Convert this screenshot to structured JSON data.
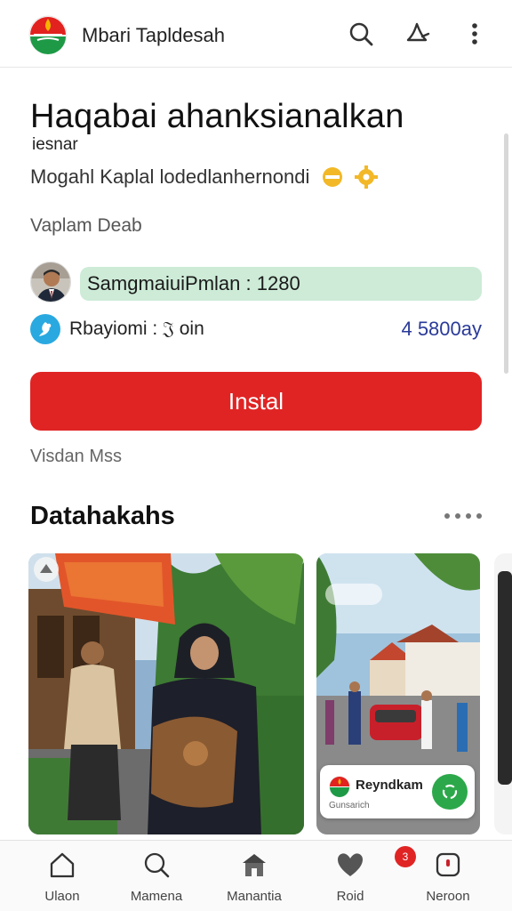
{
  "app_bar": {
    "app_name": "Mbari Tapldesah",
    "actions": [
      "search-icon",
      "share-icon",
      "more-vertical-icon"
    ]
  },
  "listing": {
    "title": "Haqabai ahanksianalkan",
    "subtitle": "iesnar",
    "description": "Mogahl Kaplal lodedlanhernondi",
    "secondary_text": "Vaplam Deab",
    "developer_pill": "SamgmaiuiPmlan : 1280",
    "rating_label": "Rbayiomi : 𝔍 oin",
    "rating_count": "4 5800ay",
    "install_label": "Instal",
    "below_button_text": "Visdan Mss"
  },
  "section": {
    "title": "Datahakahs"
  },
  "cards": [
    {
      "type": "photo"
    },
    {
      "type": "photo",
      "overlay_title": "Reyndkam",
      "overlay_sub": "Gunsarich"
    }
  ],
  "bottom_nav": {
    "items": [
      {
        "label": "Ulaon",
        "icon": "home-icon"
      },
      {
        "label": "Mamena",
        "icon": "search-icon"
      },
      {
        "label": "Manantia",
        "icon": "store-icon"
      },
      {
        "label": "Roid",
        "icon": "heart-icon"
      },
      {
        "label": "Neroon",
        "icon": "profile-icon"
      }
    ],
    "badge_count": "3"
  },
  "colors": {
    "accent_red": "#e02424",
    "pill_green": "#cdebd7",
    "link_blue": "#2a3a99",
    "info_blue": "#29a9e0"
  }
}
